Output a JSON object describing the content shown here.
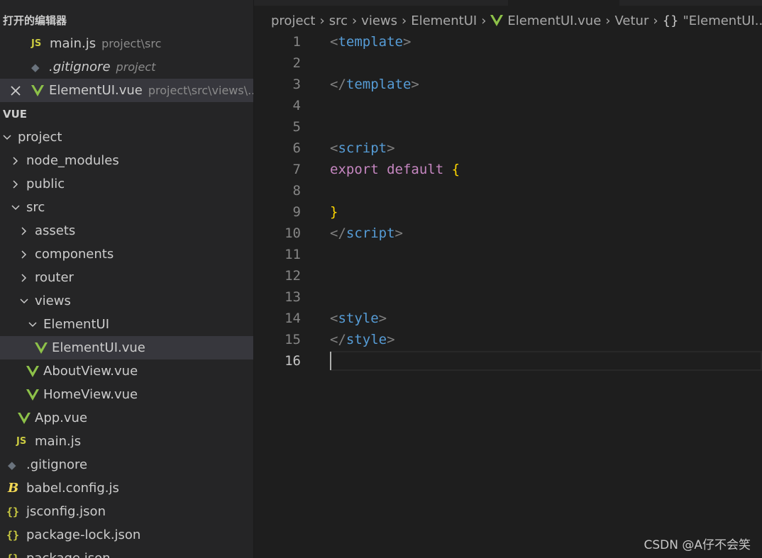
{
  "open_editors": {
    "title": "打开的编辑器",
    "items": [
      {
        "name": "main.js",
        "desc": "project\\src"
      },
      {
        "name": ".gitignore",
        "desc": "project"
      },
      {
        "name": "ElementUI.vue",
        "desc": "project\\src\\views\\..."
      }
    ]
  },
  "explorer": {
    "title": "VUE",
    "tree": [
      {
        "label": "project"
      },
      {
        "label": "node_modules"
      },
      {
        "label": "public"
      },
      {
        "label": "src"
      },
      {
        "label": "assets"
      },
      {
        "label": "components"
      },
      {
        "label": "router"
      },
      {
        "label": "views"
      },
      {
        "label": "ElementUI"
      },
      {
        "label": "ElementUI.vue"
      },
      {
        "label": "AboutView.vue"
      },
      {
        "label": "HomeView.vue"
      },
      {
        "label": "App.vue"
      },
      {
        "label": "main.js"
      },
      {
        "label": ".gitignore"
      },
      {
        "label": "babel.config.js"
      },
      {
        "label": "jsconfig.json"
      },
      {
        "label": "package-lock.json"
      },
      {
        "label": "package.json"
      }
    ]
  },
  "icons": {
    "js": "JS",
    "json": "{}",
    "babel": "B",
    "git": "◆"
  },
  "breadcrumb": [
    "project",
    "src",
    "views",
    "ElementUI",
    "ElementUI.vue",
    "Vetur",
    "\"ElementUI..."
  ],
  "breadcrumb_braces": "{}",
  "code": {
    "lines": [
      "1",
      "2",
      "3",
      "4",
      "5",
      "6",
      "7",
      "8",
      "9",
      "10",
      "11",
      "12",
      "13",
      "14",
      "15",
      "16"
    ],
    "active_line": "16",
    "template_tag": "template",
    "script_tag": "script",
    "style_tag": "style",
    "export": "export",
    "default": "default",
    "open_brace": "{",
    "close_brace": "}",
    "lt": "<",
    "lt_close": "</",
    "gt": ">"
  },
  "watermark": "CSDN @A仔不会笑",
  "colors": {
    "vue_green": "#41b883",
    "tag_blue": "#569cd6",
    "keyword_pink": "#c586c0",
    "brace_gold": "#ffd700"
  }
}
